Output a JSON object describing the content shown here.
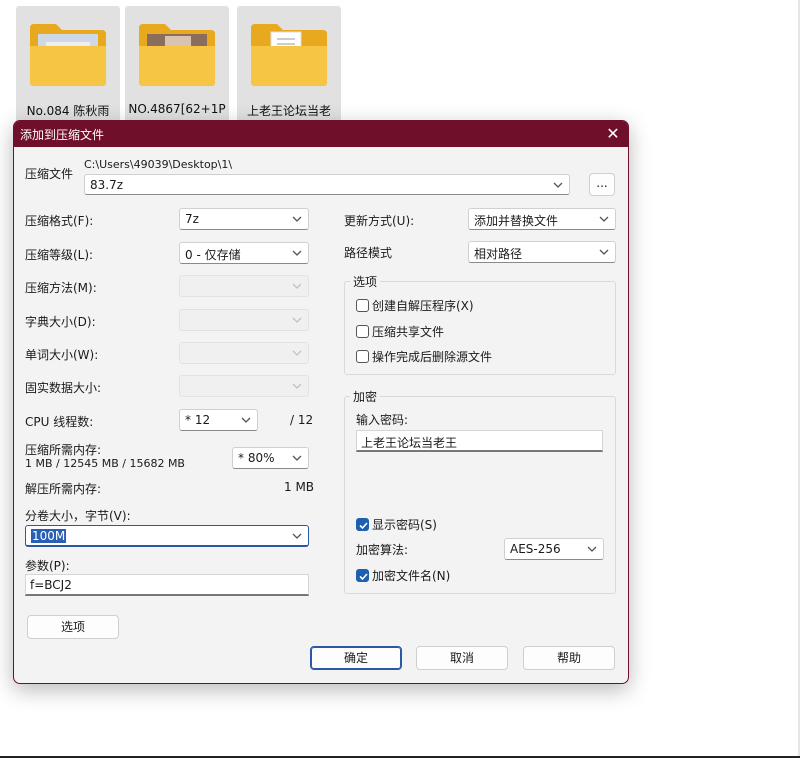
{
  "desktop": {
    "folders": [
      {
        "label": "No.084 陈秋雨"
      },
      {
        "label": "NO.4867[62+1P"
      },
      {
        "label": "上老王论坛当老"
      }
    ]
  },
  "dialog": {
    "title": "添加到压缩文件",
    "close_glyph": "✕",
    "archive": {
      "label": "压缩文件",
      "path": "C:\\Users\\49039\\Desktop\\1\\",
      "filename": "83.7z",
      "browse_label": "..."
    },
    "left": {
      "format": {
        "label": "压缩格式(F):",
        "value": "7z"
      },
      "level": {
        "label": "压缩等级(L):",
        "value": "0 - 仅存储"
      },
      "method": {
        "label": "压缩方法(M):",
        "value": ""
      },
      "dict": {
        "label": "字典大小(D):",
        "value": ""
      },
      "word": {
        "label": "单词大小(W):",
        "value": ""
      },
      "solid": {
        "label": "固实数据大小:",
        "value": ""
      },
      "threads": {
        "label": "CPU 线程数:",
        "value": "* 12",
        "max": "/ 12"
      },
      "memory": {
        "label": "压缩所需内存:",
        "detail": "1 MB / 12545 MB / 15682 MB",
        "value": "* 80%"
      },
      "decompress": {
        "label": "解压所需内存:",
        "value": "1 MB"
      },
      "volume": {
        "label": "分卷大小，字节(V):",
        "value": "100M"
      },
      "params": {
        "label": "参数(P):",
        "value": "f=BCJ2"
      },
      "options_button": "选项"
    },
    "right": {
      "update": {
        "label": "更新方式(U):",
        "value": "添加并替换文件"
      },
      "pathmode": {
        "label": "路径模式",
        "value": "相对路径"
      },
      "options_group": {
        "title": "选项",
        "sfx": {
          "label": "创建自解压程序(X)",
          "checked": false
        },
        "shared": {
          "label": "压缩共享文件",
          "checked": false
        },
        "delete": {
          "label": "操作完成后删除源文件",
          "checked": false
        }
      },
      "encryption": {
        "title": "加密",
        "password_label": "输入密码:",
        "password": "上老王论坛当老王",
        "show_password": {
          "label": "显示密码(S)",
          "checked": true
        },
        "method_label": "加密算法:",
        "method_value": "AES-256",
        "encrypt_names": {
          "label": "加密文件名(N)",
          "checked": true
        }
      }
    },
    "buttons": {
      "ok": "确定",
      "cancel": "取消",
      "help": "帮助"
    }
  },
  "colors": {
    "titlebar": "#6f0f2a",
    "accent": "#1f5fb0",
    "folder": "#f6c544"
  }
}
